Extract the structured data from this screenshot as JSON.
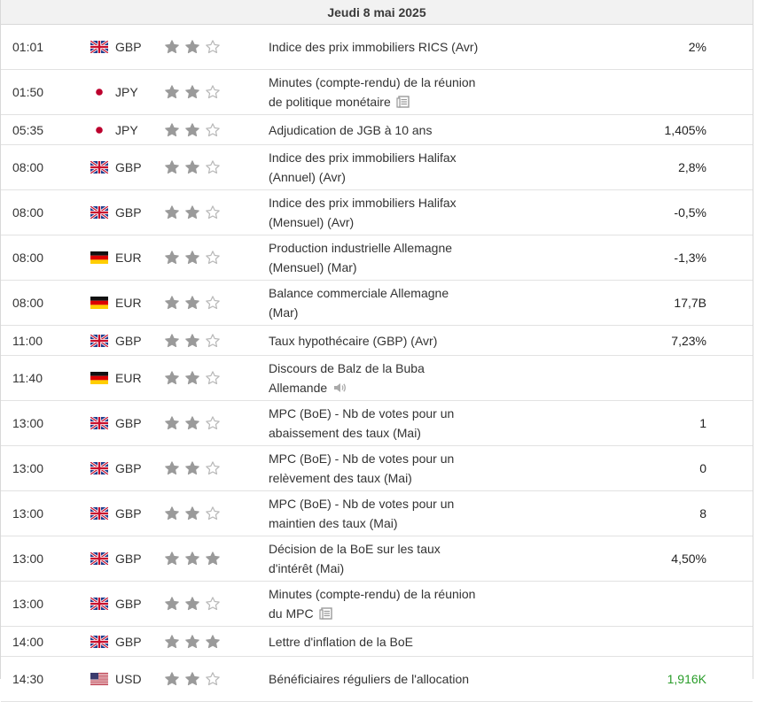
{
  "header": {
    "date": "Jeudi 8 mai 2025"
  },
  "colors": {
    "actual_positive": "#2a9d2a",
    "star_filled": "#9a9a9a",
    "star_empty": "#b8b8b8"
  },
  "events": [
    {
      "time": "01:01",
      "country": "uk",
      "currency": "GBP",
      "importance": 2,
      "title": "Indice des prix immobiliers RICS (Avr)",
      "icon": "",
      "actual": "2%"
    },
    {
      "time": "01:50",
      "country": "jp",
      "currency": "JPY",
      "importance": 2,
      "title": "Minutes (compte-rendu) de la réunion de politique monétaire",
      "icon": "document-icon",
      "actual": ""
    },
    {
      "time": "05:35",
      "country": "jp",
      "currency": "JPY",
      "importance": 2,
      "title": "Adjudication de JGB à 10 ans",
      "icon": "",
      "actual": "1,405%"
    },
    {
      "time": "08:00",
      "country": "uk",
      "currency": "GBP",
      "importance": 2,
      "title": "Indice des prix immobiliers Halifax (Annuel) (Avr)",
      "icon": "",
      "actual": "2,8%"
    },
    {
      "time": "08:00",
      "country": "uk",
      "currency": "GBP",
      "importance": 2,
      "title": "Indice des prix immobiliers Halifax (Mensuel) (Avr)",
      "icon": "",
      "actual": "-0,5%"
    },
    {
      "time": "08:00",
      "country": "de",
      "currency": "EUR",
      "importance": 2,
      "title": "Production industrielle Allemagne (Mensuel) (Mar)",
      "icon": "",
      "actual": "-1,3%"
    },
    {
      "time": "08:00",
      "country": "de",
      "currency": "EUR",
      "importance": 2,
      "title": "Balance commerciale Allemagne (Mar)",
      "icon": "",
      "actual": "17,7B"
    },
    {
      "time": "11:00",
      "country": "uk",
      "currency": "GBP",
      "importance": 2,
      "title": "Taux hypothécaire (GBP) (Avr)",
      "icon": "",
      "actual": "7,23%"
    },
    {
      "time": "11:40",
      "country": "de",
      "currency": "EUR",
      "importance": 2,
      "title": "Discours de Balz de la Buba Allemande",
      "icon": "speaker-icon",
      "actual": ""
    },
    {
      "time": "13:00",
      "country": "uk",
      "currency": "GBP",
      "importance": 2,
      "title": "MPC (BoE) - Nb de votes pour un abaissement des taux (Mai)",
      "icon": "",
      "actual": "1"
    },
    {
      "time": "13:00",
      "country": "uk",
      "currency": "GBP",
      "importance": 2,
      "title": "MPC (BoE) - Nb de votes pour un relèvement des taux (Mai)",
      "icon": "",
      "actual": "0"
    },
    {
      "time": "13:00",
      "country": "uk",
      "currency": "GBP",
      "importance": 2,
      "title": "MPC (BoE) - Nb de votes pour un maintien des taux (Mai)",
      "icon": "",
      "actual": "8"
    },
    {
      "time": "13:00",
      "country": "uk",
      "currency": "GBP",
      "importance": 3,
      "title": "Décision de la BoE sur les taux d'intérêt (Mai)",
      "icon": "",
      "actual": "4,50%"
    },
    {
      "time": "13:00",
      "country": "uk",
      "currency": "GBP",
      "importance": 2,
      "title": "Minutes (compte-rendu) de la réunion du MPC",
      "icon": "document-icon",
      "actual": ""
    },
    {
      "time": "14:00",
      "country": "uk",
      "currency": "GBP",
      "importance": 3,
      "title": "Lettre d'inflation de la BoE",
      "icon": "",
      "actual": ""
    },
    {
      "time": "14:30",
      "country": "us",
      "currency": "USD",
      "importance": 2,
      "title": "Bénéficiaires réguliers de l'allocation",
      "icon": "",
      "actual": "1,916K",
      "actual_positive": true
    }
  ]
}
